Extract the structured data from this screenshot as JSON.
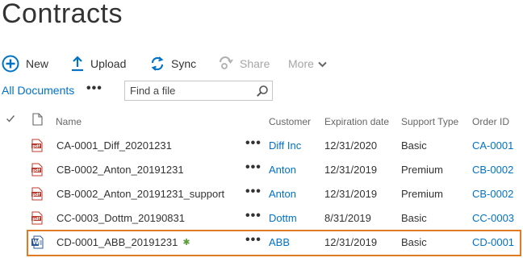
{
  "page": {
    "title": "Contracts"
  },
  "toolbar": {
    "new_label": "New",
    "upload_label": "Upload",
    "sync_label": "Sync",
    "share_label": "Share",
    "more_label": "More"
  },
  "view": {
    "name": "All Documents",
    "ellipsis": "•••",
    "search_placeholder": "Find a file"
  },
  "colors": {
    "link": "#0072c6",
    "highlight_border": "#e07b24",
    "pdf_red": "#c0392b",
    "word_blue": "#2b579a"
  },
  "list": {
    "columns": {
      "name": "Name",
      "customer": "Customer",
      "expiration": "Expiration date",
      "support": "Support Type",
      "order": "Order ID"
    },
    "row_menu": "•••",
    "new_indicator": "✱",
    "rows": [
      {
        "icon": "pdf-icon",
        "name": "CA-0001_Diff_20201231",
        "customer": "Diff Inc",
        "expiration": "12/31/2020",
        "support": "Basic",
        "order": "CA-0001"
      },
      {
        "icon": "pdf-icon",
        "name": "CB-0002_Anton_20191231",
        "customer": "Anton",
        "expiration": "12/31/2019",
        "support": "Premium",
        "order": "CB-0002"
      },
      {
        "icon": "pdf-icon",
        "name": "CB-0002_Anton_20191231_support",
        "customer": "Anton",
        "expiration": "12/31/2019",
        "support": "Premium",
        "order": "CB-0002"
      },
      {
        "icon": "pdf-icon",
        "name": "CC-0003_Dottm_20190831",
        "customer": "Dottm",
        "expiration": "8/31/2019",
        "support": "Basic",
        "order": "CC-0003"
      },
      {
        "icon": "word-doc-icon",
        "name": "CD-0001_ABB_20191231",
        "customer": "ABB",
        "expiration": "12/31/2019",
        "support": "Basic",
        "order": "CD-0001",
        "highlighted": true,
        "is_new": true
      }
    ]
  }
}
